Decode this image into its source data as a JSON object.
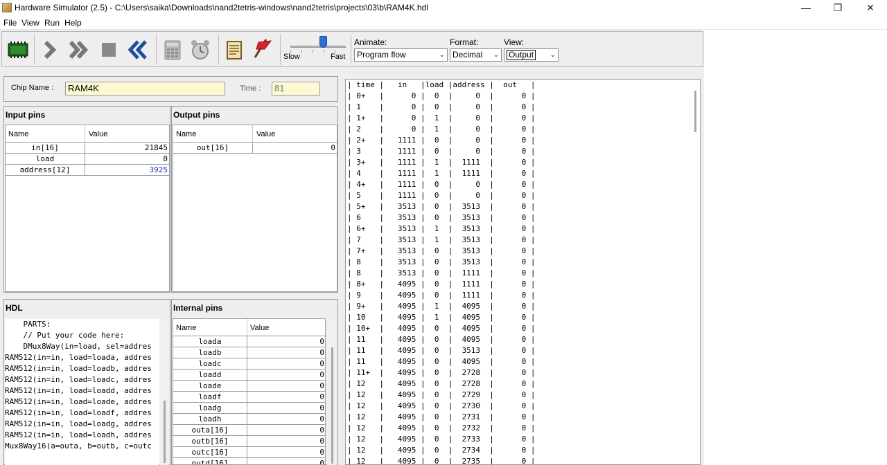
{
  "window": {
    "title": "Hardware Simulator (2.5) - C:\\Users\\saika\\Downloads\\nand2tetris-windows\\nand2tetris\\projects\\03\\b\\RAM4K.hdl",
    "minimize": "—",
    "maximize": "❐",
    "close": "✕"
  },
  "menu": [
    "File",
    "View",
    "Run",
    "Help"
  ],
  "toolbar": {
    "slow_label": "Slow",
    "fast_label": "Fast",
    "speed_fraction": 0.6,
    "animate_label": "Animate:",
    "animate_value": "Program flow",
    "format_label": "Format:",
    "format_value": "Decimal",
    "view_label": "View:",
    "view_value": "Output"
  },
  "chip": {
    "name_label": "Chip Name :",
    "name_value": "RAM4K",
    "time_label": "Time :",
    "time_value": "81"
  },
  "input_pins": {
    "title": "Input pins",
    "col_name": "Name",
    "col_value": "Value",
    "rows": [
      {
        "name": "in[16]",
        "value": "21845"
      },
      {
        "name": "load",
        "value": "0"
      },
      {
        "name": "address[12]",
        "value": "3925"
      }
    ]
  },
  "output_pins": {
    "title": "Output pins",
    "col_name": "Name",
    "col_value": "Value",
    "rows": [
      {
        "name": "out[16]",
        "value": "0"
      }
    ]
  },
  "hdl": {
    "title": "HDL",
    "lines": [
      "    PARTS:",
      "    // Put your code here:",
      "    DMux8Way(in=load, sel=addres",
      "RAM512(in=in, load=loada, addres",
      "RAM512(in=in, load=loadb, addres",
      "RAM512(in=in, load=loadc, addres",
      "RAM512(in=in, load=loadd, addres",
      "RAM512(in=in, load=loade, addres",
      "RAM512(in=in, load=loadf, addres",
      "RAM512(in=in, load=loadg, addres",
      "RAM512(in=in, load=loadh, addres",
      "Mux8Way16(a=outa, b=outb, c=outc"
    ]
  },
  "internal_pins": {
    "title": "Internal pins",
    "col_name": "Name",
    "col_value": "Value",
    "rows": [
      {
        "name": "loada",
        "value": "0"
      },
      {
        "name": "loadb",
        "value": "0"
      },
      {
        "name": "loadc",
        "value": "0"
      },
      {
        "name": "loadd",
        "value": "0"
      },
      {
        "name": "loade",
        "value": "0"
      },
      {
        "name": "loadf",
        "value": "0"
      },
      {
        "name": "loadg",
        "value": "0"
      },
      {
        "name": "loadh",
        "value": "0"
      },
      {
        "name": "outa[16]",
        "value": "0"
      },
      {
        "name": "outb[16]",
        "value": "0"
      },
      {
        "name": "outc[16]",
        "value": "0"
      },
      {
        "name": "outd[16]",
        "value": "0"
      }
    ]
  },
  "output_table": {
    "header": "| time |   in   |load |address |  out   |",
    "lines": [
      "| 0+   |      0 |  0  |     0  |      0 |",
      "| 1    |      0 |  0  |     0  |      0 |",
      "| 1+   |      0 |  1  |     0  |      0 |",
      "| 2    |      0 |  1  |     0  |      0 |",
      "| 2+   |   1111 |  0  |     0  |      0 |",
      "| 3    |   1111 |  0  |     0  |      0 |",
      "| 3+   |   1111 |  1  |  1111  |      0 |",
      "| 4    |   1111 |  1  |  1111  |      0 |",
      "| 4+   |   1111 |  0  |     0  |      0 |",
      "| 5    |   1111 |  0  |     0  |      0 |",
      "| 5+   |   3513 |  0  |  3513  |      0 |",
      "| 6    |   3513 |  0  |  3513  |      0 |",
      "| 6+   |   3513 |  1  |  3513  |      0 |",
      "| 7    |   3513 |  1  |  3513  |      0 |",
      "| 7+   |   3513 |  0  |  3513  |      0 |",
      "| 8    |   3513 |  0  |  3513  |      0 |",
      "| 8    |   3513 |  0  |  1111  |      0 |",
      "| 8+   |   4095 |  0  |  1111  |      0 |",
      "| 9    |   4095 |  0  |  1111  |      0 |",
      "| 9+   |   4095 |  1  |  4095  |      0 |",
      "| 10   |   4095 |  1  |  4095  |      0 |",
      "| 10+  |   4095 |  0  |  4095  |      0 |",
      "| 11   |   4095 |  0  |  4095  |      0 |",
      "| 11   |   4095 |  0  |  3513  |      0 |",
      "| 11   |   4095 |  0  |  4095  |      0 |",
      "| 11+  |   4095 |  0  |  2728  |      0 |",
      "| 12   |   4095 |  0  |  2728  |      0 |",
      "| 12   |   4095 |  0  |  2729  |      0 |",
      "| 12   |   4095 |  0  |  2730  |      0 |",
      "| 12   |   4095 |  0  |  2731  |      0 |",
      "| 12   |   4095 |  0  |  2732  |      0 |",
      "| 12   |   4095 |  0  |  2733  |      0 |",
      "| 12   |   4095 |  0  |  2734  |      0 |",
      "| 12   |   4095 |  0  |  2735  |      0 |"
    ]
  },
  "colors": {
    "chip_name_bg": "#fdf9d3",
    "highlight_value": "#1a33cc",
    "panel_bg": "#eeeeee"
  }
}
